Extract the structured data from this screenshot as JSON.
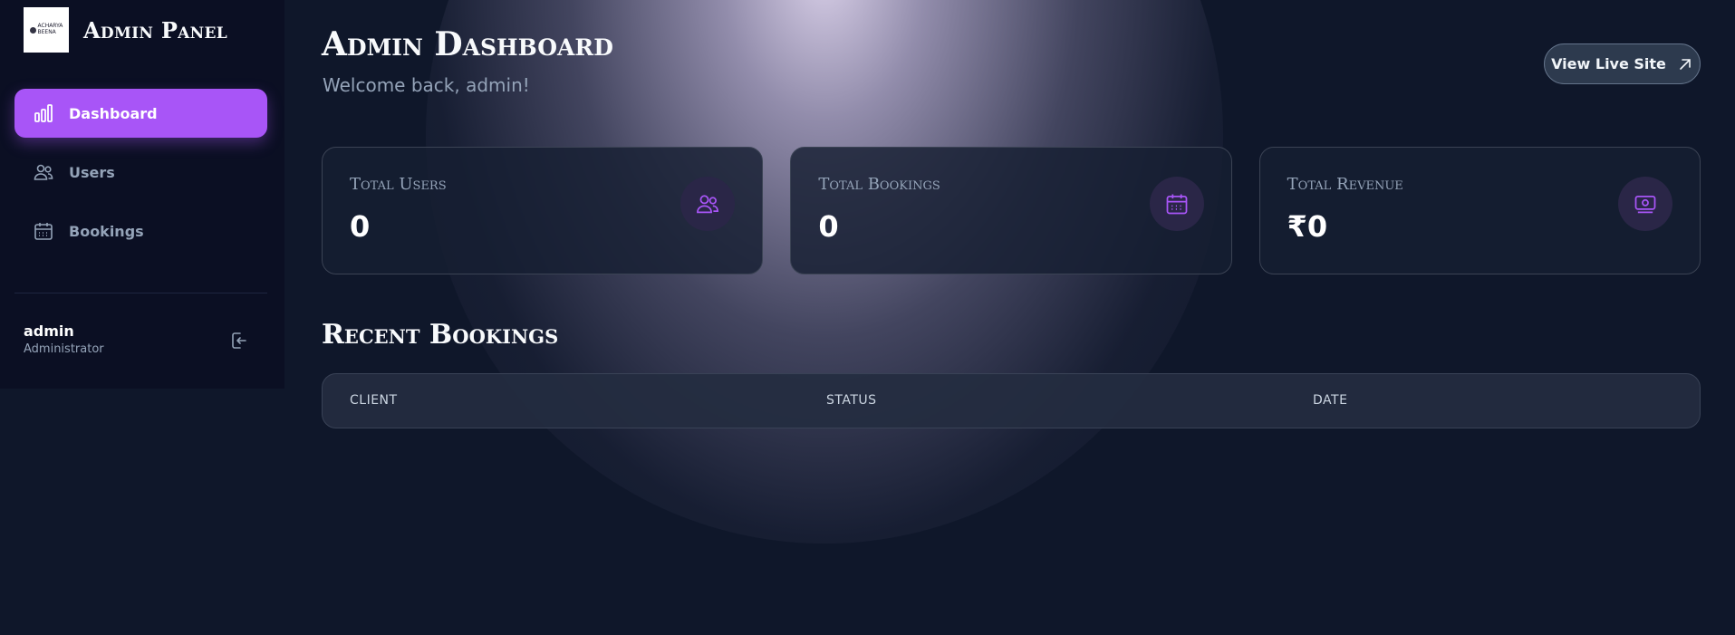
{
  "sidebar": {
    "logo_text": "ACHARYA BEENA",
    "brand_title": "Admin Panel",
    "items": [
      {
        "label": "Dashboard",
        "icon": "bar-chart-icon",
        "active": true
      },
      {
        "label": "Users",
        "icon": "users-icon",
        "active": false
      },
      {
        "label": "Bookings",
        "icon": "calendar-icon",
        "active": false
      }
    ],
    "user": {
      "name": "admin",
      "role": "Administrator"
    }
  },
  "header": {
    "title": "Admin Dashboard",
    "subtitle": "Welcome back, admin!",
    "live_button": "View Live Site"
  },
  "stats": [
    {
      "label": "Total Users",
      "value": "0",
      "icon": "users-icon"
    },
    {
      "label": "Total Bookings",
      "value": "0",
      "icon": "calendar-icon"
    },
    {
      "label": "Total Revenue",
      "value": "₹0",
      "icon": "money-icon"
    }
  ],
  "recent": {
    "title": "Recent Bookings",
    "columns": [
      "CLIENT",
      "STATUS",
      "DATE"
    ]
  },
  "colors": {
    "accent": "#a855f7",
    "background": "#0f172a",
    "sidebar": "#0b0f23"
  }
}
